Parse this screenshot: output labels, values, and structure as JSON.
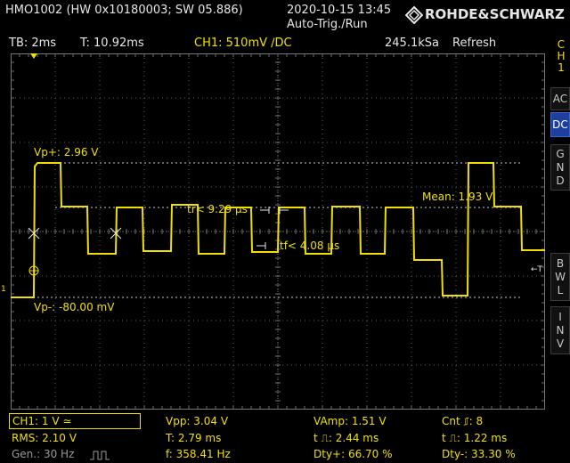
{
  "topbar": {
    "device_info": "HMO1002 (HW 0x10180003; SW 05.886)",
    "datetime": "2020-10-15 13:45",
    "trigger_state": "Auto-Trig./Run",
    "brand": "ROHDE&SCHWARZ",
    "brand_logo_icon": "rohde-schwarz-diamond-logo"
  },
  "infobar": {
    "timebase": "TB: 2ms",
    "trigger_time": "T: 10.92ms",
    "channel_setting": "CH1: 510mV ∕DC",
    "sample_rate": "245.1kSa",
    "mode": "Refresh"
  },
  "sidebar": {
    "channel": [
      "C",
      "H",
      "1"
    ],
    "coupling_ac": [
      "A",
      "C"
    ],
    "coupling_dc": [
      "D",
      "C"
    ],
    "coupling_gnd": [
      "G",
      "N",
      "D"
    ],
    "bwl": [
      "B",
      "W",
      "L"
    ],
    "inv": [
      "I",
      "N",
      "V"
    ]
  },
  "markers": {
    "vp_plus": "Vp+: 2.96 V",
    "vp_minus": "Vp-: -80.00 mV",
    "mean": "Mean: 1.93 V",
    "tr": "tr< 9.29 µs",
    "tf": "tf< 4.08 µs",
    "ch_ref": "1",
    "trigger_level": "←T"
  },
  "measurements": {
    "ch1_scale": "CH1: 1 V ≃",
    "rms": "RMS: 2.10 V",
    "gen": "Gen.: 30 Hz",
    "vpp": "Vpp: 3.04 V",
    "period": "T: 2.79 ms",
    "freq": "f: 358.41 Hz",
    "vamp": "VAmp: 1.51 V",
    "pos_width": "t ⎍: 2.44 ms",
    "duty_pos": "Dty+: 66.70 %",
    "cnt": "Cnt ⎎: 8",
    "neg_width": "t ⎍: 1.22 ms",
    "duty_neg": "Dty-: 33.30 %"
  },
  "colors": {
    "trace": "#f0e000",
    "background": "#000000",
    "grid": "#6e6e6e",
    "active_button": "#1e3f9c"
  }
}
